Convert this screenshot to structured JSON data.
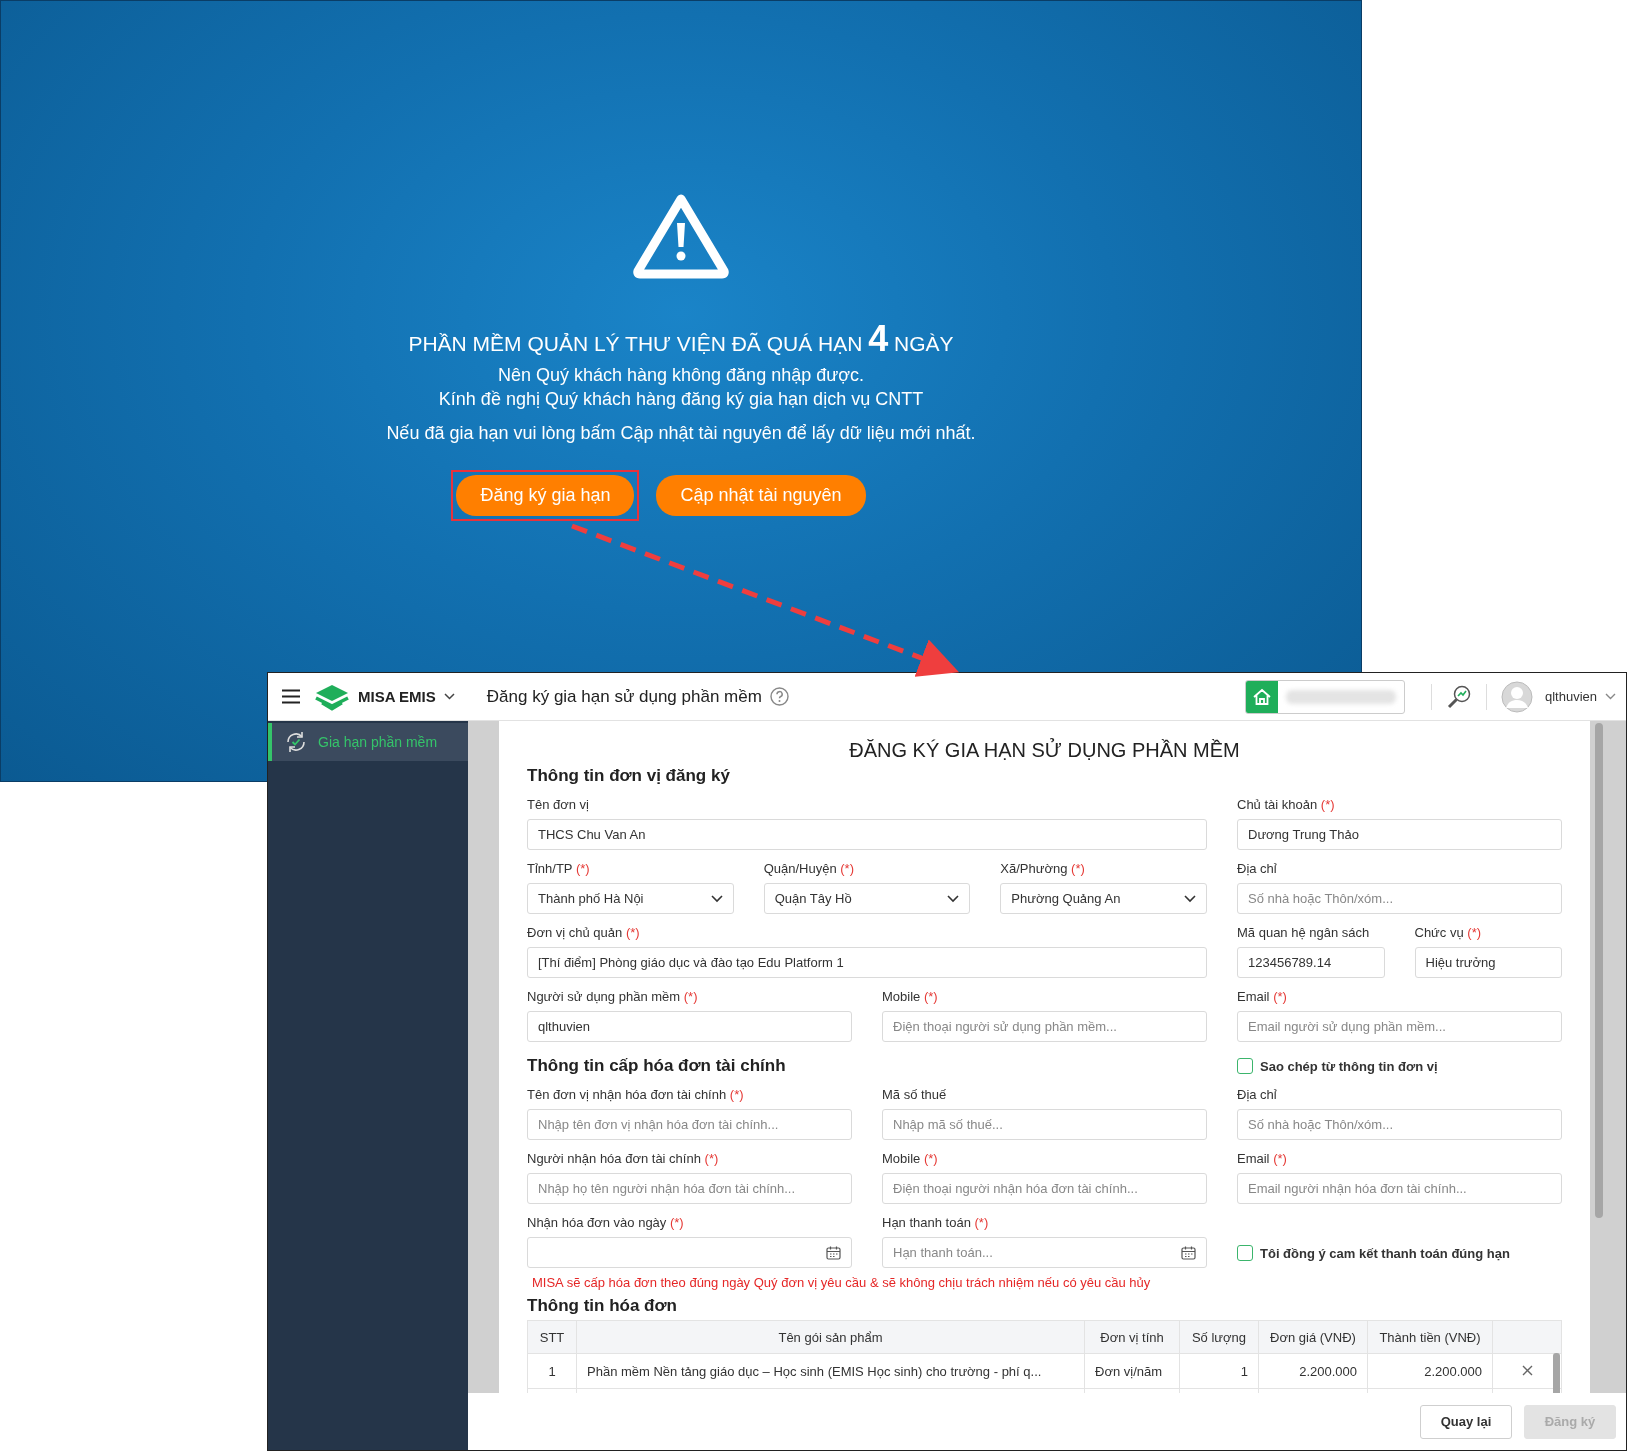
{
  "alert": {
    "title": "PHẦN MỀM QUẢN LÝ THƯ VIỆN ĐÃ QUÁ HẠN **4** NGÀY",
    "lines": [
      "Nên Quý khách hàng không đăng nhập được.",
      "Kính đề nghị Quý khách hàng đăng ký gia hạn dịch vụ CNTT"
    ],
    "note": "Nếu đã gia hạn vui lòng bấm Cập nhật tài nguyên để lấy dữ liệu mới nhất.",
    "buttons": [
      {
        "label": "Đăng ký gia hạn",
        "highlighted": true
      },
      {
        "label": "Cập nhật tài nguyên",
        "highlighted": false
      }
    ]
  },
  "window": {
    "app_name": "MISA EMIS",
    "page_title": "Đăng ký gia hạn sử dụng phần mềm",
    "user": "qlthuvien"
  },
  "sidebar": {
    "items": [
      {
        "label": "Gia hạn phần mềm",
        "selected": true
      }
    ]
  },
  "form": {
    "title": "ĐĂNG KÝ GIA HẠN SỬ DỤNG PHẦN MỀM",
    "registration": {
      "heading": "Thông tin đơn vị đăng ký",
      "fields": [
        {
          "kind": "text",
          "label": "Tên đơn vị",
          "value": "THCS Chu Van An"
        },
        {
          "kind": "text",
          "label": "Chủ tài khoản",
          "required": "(*)",
          "value": "Dương Trung Thảo"
        },
        {
          "kind": "select",
          "label": "Tỉnh/TP",
          "required": "(*)",
          "value": "Thành phố Hà Nội"
        },
        {
          "kind": "select",
          "label": "Quận/Huyện",
          "required": "(*)",
          "value": "Quận Tây Hồ"
        },
        {
          "kind": "select",
          "label": "Xã/Phường",
          "required": "(*)",
          "value": "Phường Quảng An"
        },
        {
          "kind": "text",
          "label": "Địa chỉ",
          "placeholder": "Số nhà hoặc Thôn/xóm..."
        },
        {
          "kind": "text",
          "label": "Đơn vị chủ quản",
          "required": "(*)",
          "value": "[Thí điểm] Phòng giáo dục và đào tạo Edu Platform 1"
        },
        {
          "kind": "text",
          "label": "Mã quan hệ ngân sách",
          "value": "123456789.14"
        },
        {
          "kind": "text",
          "label": "Chức vụ",
          "required": "(*)",
          "value": "Hiệu trưởng"
        },
        {
          "kind": "text",
          "label": "Người sử dụng phần mềm",
          "required": "(*)",
          "value": "qlthuvien"
        },
        {
          "kind": "text",
          "label": "Mobile",
          "required": "(*)",
          "placeholder": "Điện thoại người sử dụng phần mềm..."
        },
        {
          "kind": "text",
          "label": "Email",
          "required": "(*)",
          "placeholder": "Email người sử dụng phần mềm..."
        }
      ]
    },
    "invoice": {
      "heading": "Thông tin cấp hóa đơn tài chính",
      "copy_checkbox": {
        "label": "Sao chép từ thông tin đơn vị",
        "checked": false
      },
      "fields": [
        {
          "kind": "text",
          "label": "Tên đơn vị nhận hóa đơn tài chính",
          "required": "(*)",
          "placeholder": "Nhập tên đơn vị nhận hóa đơn tài chính..."
        },
        {
          "kind": "text",
          "label": "Mã số thuế",
          "placeholder": "Nhập mã số thuế..."
        },
        {
          "kind": "text",
          "label": "Địa chỉ",
          "placeholder": "Số nhà hoặc Thôn/xóm..."
        },
        {
          "kind": "text",
          "label": "Người nhận hóa đơn tài chính",
          "required": "(*)",
          "placeholder": "Nhập họ tên người nhận hóa đơn tài chính..."
        },
        {
          "kind": "text",
          "label": "Mobile",
          "required": "(*)",
          "placeholder": "Điện thoại người nhận hóa đơn tài chính..."
        },
        {
          "kind": "text",
          "label": "Email",
          "required": "(*)",
          "placeholder": "Email người nhận hóa đơn tài chính..."
        },
        {
          "kind": "date",
          "label": "Nhận hóa đơn vào ngày",
          "required": "(*)"
        },
        {
          "kind": "date",
          "label": "Hạn thanh toán",
          "required": "(*)",
          "placeholder": "Hạn thanh toán..."
        }
      ],
      "agree_checkbox": {
        "label": "Tôi đồng ý cam kết thanh toán đúng hạn",
        "checked": false
      },
      "note": "MISA sẽ cấp hóa đơn theo đúng ngày Quý đơn vị yêu cầu & sẽ không chịu trách nhiệm nếu có yêu cầu hủy"
    },
    "invoice_table": {
      "heading": "Thông tin hóa đơn",
      "columns": [
        "STT",
        "Tên gói sản phẩm",
        "Đơn vị tính",
        "Số lượng",
        "Đơn giá (VNĐ)",
        "Thành tiền (VNĐ)"
      ],
      "rows": [
        {
          "cells": [
            "1",
            "Phần mềm Nền tảng giáo dục – Học sinh (EMIS Học sinh) cho trường - phí q...",
            "Đơn vị/năm",
            "1",
            "2.200.000",
            "2.200.000"
          ]
        }
      ]
    }
  },
  "footer_buttons": [
    {
      "label": "Quay lại",
      "disabled": false
    },
    {
      "label": "Đăng ký",
      "disabled": true
    }
  ]
}
